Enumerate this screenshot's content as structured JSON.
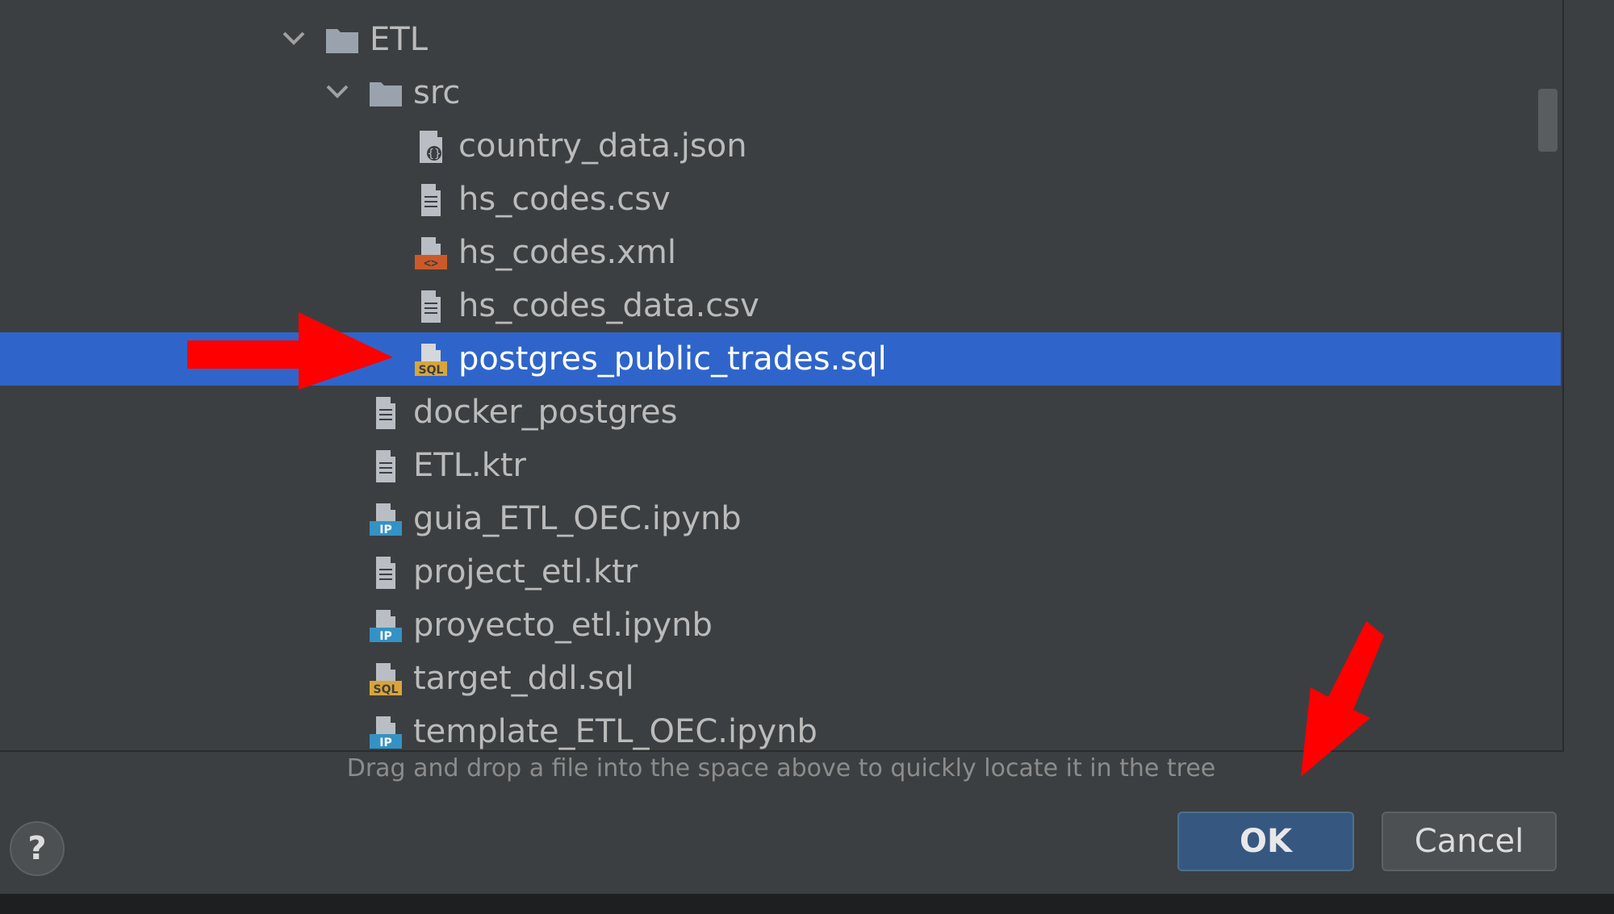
{
  "tree": {
    "rows": [
      {
        "label": "ETL",
        "icon": "folder-icon",
        "expanded": true
      },
      {
        "label": "src",
        "icon": "folder-icon",
        "expanded": true
      },
      {
        "label": "country_data.json",
        "icon": "json-file-icon"
      },
      {
        "label": "hs_codes.csv",
        "icon": "text-file-icon"
      },
      {
        "label": "hs_codes.xml",
        "icon": "xml-file-icon"
      },
      {
        "label": "hs_codes_data.csv",
        "icon": "text-file-icon"
      },
      {
        "label": "postgres_public_trades.sql",
        "icon": "sql-file-icon",
        "selected": true
      },
      {
        "label": "docker_postgres",
        "icon": "text-file-icon"
      },
      {
        "label": "ETL.ktr",
        "icon": "text-file-icon"
      },
      {
        "label": "guia_ETL_OEC.ipynb",
        "icon": "notebook-file-icon"
      },
      {
        "label": "project_etl.ktr",
        "icon": "text-file-icon"
      },
      {
        "label": "proyecto_etl.ipynb",
        "icon": "notebook-file-icon"
      },
      {
        "label": "target_ddl.sql",
        "icon": "sql-file-icon"
      },
      {
        "label": "template_ETL_OEC.ipynb",
        "icon": "notebook-file-icon"
      }
    ]
  },
  "hint": "Drag and drop a file into the space above to quickly locate it in the tree",
  "buttons": {
    "help": "?",
    "ok": "OK",
    "cancel": "Cancel"
  },
  "icon_badges": {
    "sql": "SQL",
    "notebook": "IP",
    "xml": "<>"
  },
  "colors": {
    "selection": "#2f65ca",
    "annotation_arrow": "#ff0000",
    "sql_badge": "#d9a53a",
    "notebook_badge": "#3592c4",
    "xml_badge": "#cc5a28"
  }
}
